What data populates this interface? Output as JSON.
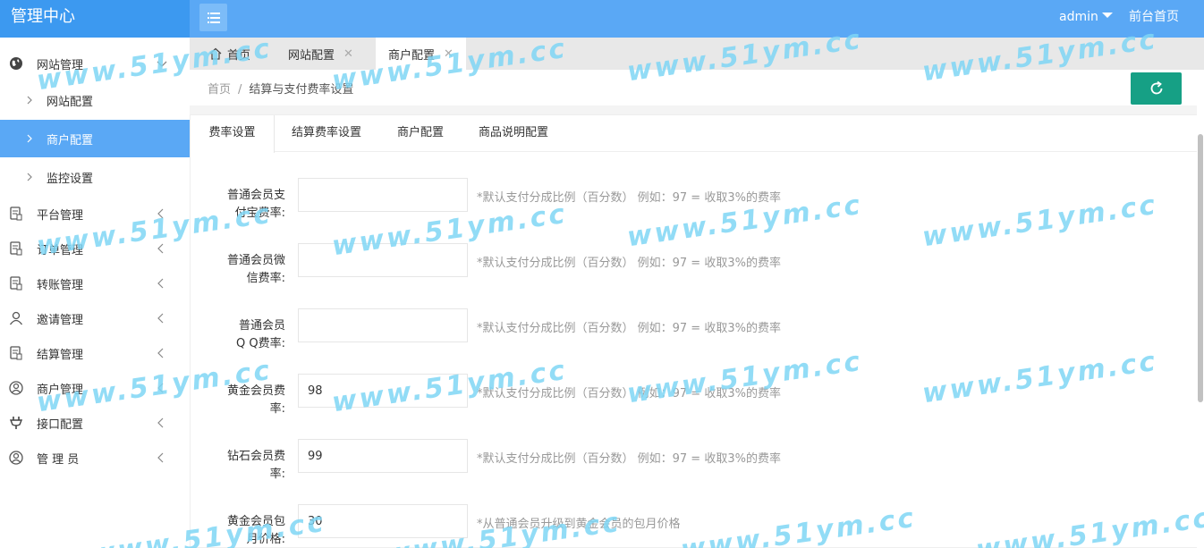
{
  "app": {
    "title": "管理中心",
    "user": "admin",
    "front_link": "前台首页"
  },
  "sidebar": {
    "groups": [
      {
        "label": "网站管理",
        "icon": "globe-icon",
        "expanded": true
      },
      {
        "label": "平台管理",
        "icon": "document-icon"
      },
      {
        "label": "订单管理",
        "icon": "document-icon"
      },
      {
        "label": "转账管理",
        "icon": "document-icon"
      },
      {
        "label": "邀请管理",
        "icon": "user-icon"
      },
      {
        "label": "结算管理",
        "icon": "document-icon"
      },
      {
        "label": "商户管理",
        "icon": "user-circle-icon"
      },
      {
        "label": "接口配置",
        "icon": "plug-icon"
      },
      {
        "label": "管 理 员",
        "icon": "user-circle-icon"
      }
    ],
    "sub_items": [
      {
        "label": "网站配置"
      },
      {
        "label": "商户配置",
        "active": true
      },
      {
        "label": "监控设置"
      }
    ]
  },
  "page_tabs": [
    {
      "label": "首页",
      "icon": "home-icon"
    },
    {
      "label": "网站配置",
      "closable": true
    },
    {
      "label": "商户配置",
      "closable": true,
      "active": true
    }
  ],
  "close_glyph": "✕",
  "breadcrumb": {
    "home": "首页",
    "separator": "/",
    "current": "结算与支付费率设置"
  },
  "sub_tabs": [
    {
      "label": "费率设置",
      "active": true
    },
    {
      "label": "结算费率设置"
    },
    {
      "label": "商户配置"
    },
    {
      "label": "商品说明配置"
    }
  ],
  "form": {
    "rows": [
      {
        "label_line1": "普通会员支",
        "label_line2": "付宝费率:",
        "value": "",
        "hint": "*默认支付分成比例（百分数） 例如：97 = 收取3%的费率"
      },
      {
        "label_line1": "普通会员微",
        "label_line2": "信费率:",
        "value": "",
        "hint": "*默认支付分成比例（百分数） 例如：97 = 收取3%的费率"
      },
      {
        "label_line1": "普通会员",
        "label_line2": "Q Q费率:",
        "value": "",
        "hint": "*默认支付分成比例（百分数） 例如：97 = 收取3%的费率"
      },
      {
        "label_line1": "黄金会员费",
        "label_line2": "率:",
        "value": "98",
        "hint": "*默认支付分成比例（百分数） 例如：97 = 收取3%的费率"
      },
      {
        "label_line1": "钻石会员费",
        "label_line2": "率:",
        "value": "99",
        "hint": "*默认支付分成比例（百分数） 例如：97 = 收取3%的费率"
      },
      {
        "label_line1": "黄金会员包",
        "label_line2": "月价格:",
        "value": "30",
        "hint": "*从普通会员升级到黄金会员的包月价格"
      }
    ]
  },
  "watermark": "www.51ym.cc",
  "colors": {
    "header": "#5aa8f5",
    "logo_bg": "#3c99f0",
    "active_item": "#5aa8f5",
    "refresh_button": "#16a085",
    "watermark": "#7fd6f5"
  }
}
